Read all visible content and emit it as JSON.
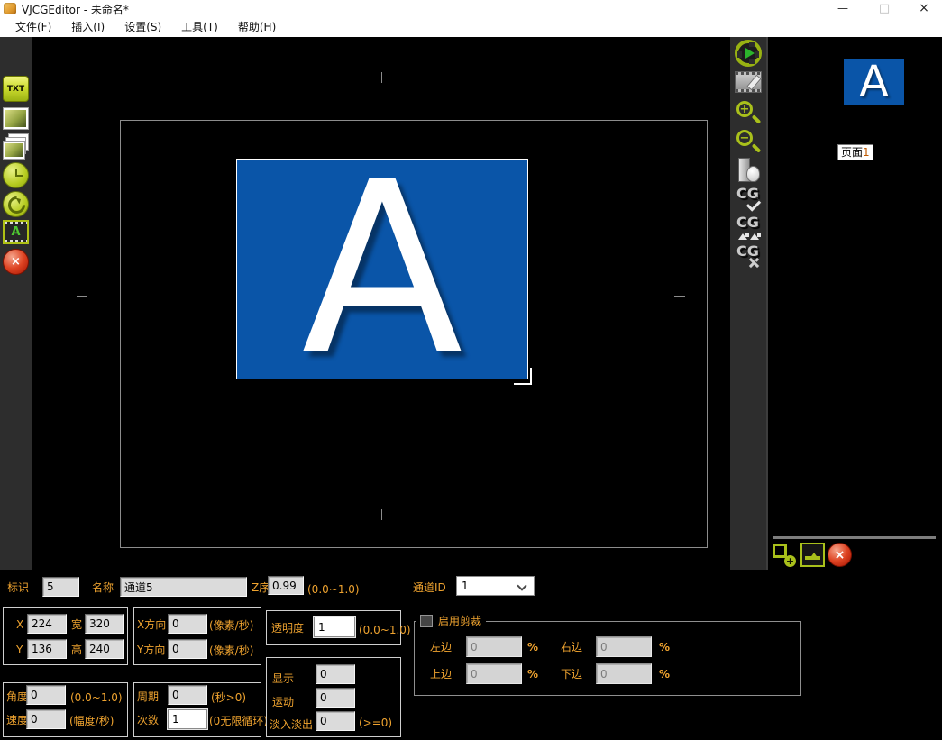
{
  "window": {
    "title": "VJCGEditor - 未命名*",
    "minimize": "—",
    "maximize": "□",
    "close": "×"
  },
  "menu": {
    "items": [
      {
        "label": "文件(F)"
      },
      {
        "label": "插入(I)"
      },
      {
        "label": "设置(S)"
      },
      {
        "label": "工具(T)"
      },
      {
        "label": "帮助(H)"
      }
    ]
  },
  "left_toolbar": {
    "text_tool_glyph": "TXT",
    "animation_tool_letter": "A",
    "delete_tool_glyph": "×"
  },
  "right_toolbar": {
    "cg_text": "CG",
    "zoom_in_glyph": "+",
    "zoom_out_glyph": "−"
  },
  "canvas": {
    "element_letter": "A"
  },
  "pages": {
    "thumb_letter": "A",
    "label_text": "页面",
    "label_number": "1",
    "add_glyph": "+",
    "delete_glyph": "×"
  },
  "props": {
    "id_label": "标识",
    "id_value": "5",
    "name_label": "名称",
    "name_value": "通道5",
    "z_label": "Z序",
    "z_value": "0.99",
    "z_hint": "(0.0~1.0)",
    "channel_label": "通道ID",
    "channel_value": "1",
    "x_label": "X",
    "x_value": "224",
    "w_label": "宽",
    "w_value": "320",
    "y_label": "Y",
    "y_value": "136",
    "h_label": "高",
    "h_value": "240",
    "dx_label": "X方向",
    "dx_value": "0",
    "dx_hint": "(像素/秒)",
    "dy_label": "Y方向",
    "dy_value": "0",
    "dy_hint": "(像素/秒)",
    "opacity_label": "透明度",
    "opacity_value": "1",
    "opacity_hint": "(0.0~1.0)",
    "angle_label": "角度",
    "angle_value": "0",
    "angle_hint": "(0.0~1.0)",
    "speed_label": "速度",
    "speed_value": "0",
    "speed_hint": "(幅度/秒)",
    "period_label": "周期",
    "period_value": "0",
    "period_hint": "(秒>0)",
    "times_label": "次数",
    "times_value": "1",
    "times_hint": "(0无限循环)",
    "display_label": "显示",
    "display_value": "0",
    "motion_label": "运动",
    "motion_value": "0",
    "fade_label": "淡入淡出",
    "fade_value": "0",
    "fade_hint": "(>=0)",
    "clip": {
      "legend": "启用剪裁",
      "left_label": "左边",
      "left_value": "0",
      "right_label": "右边",
      "right_value": "0",
      "top_label": "上边",
      "top_value": "0",
      "bottom_label": "下边",
      "bottom_value": "0",
      "percent": "%"
    }
  },
  "colors": {
    "accent_gold": "#efa32f",
    "element_blue": "#0a55a8",
    "toolbar_green": "#a9c01b",
    "delete_red": "#c62e12",
    "toolbar_bg": "#2d2d2d"
  }
}
